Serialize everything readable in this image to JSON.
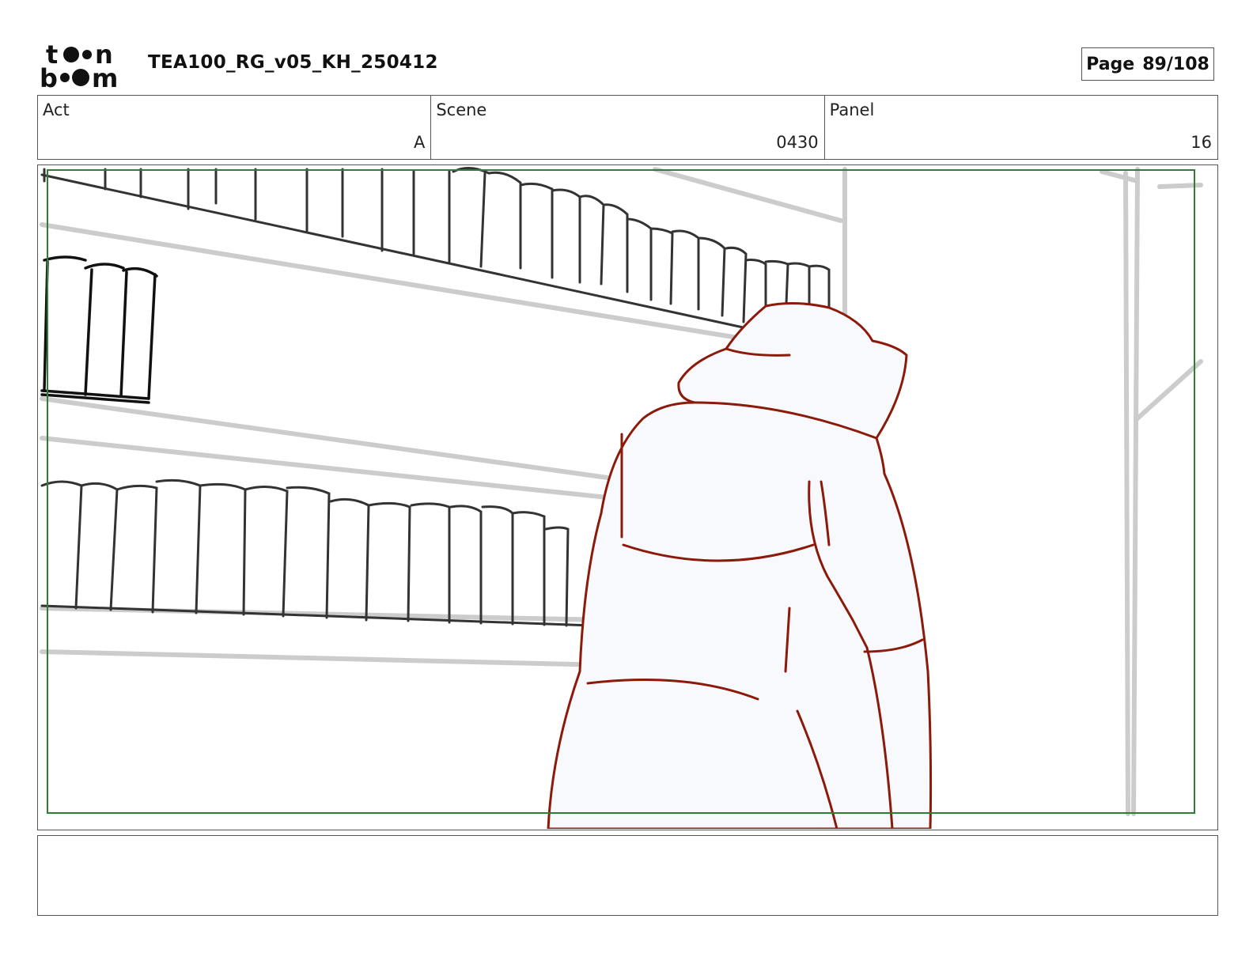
{
  "header": {
    "logo_text_top": "toon",
    "logo_text_bottom": "boom",
    "document_title": "TEA100_RG_v05_KH_250412",
    "page_label": "Page",
    "page_number": "89/108"
  },
  "info": {
    "act_label": "Act",
    "act_value": "A",
    "scene_label": "Scene",
    "scene_value": "0430",
    "panel_label": "Panel",
    "panel_value": "16"
  },
  "panel": {
    "safe_frame_color": "#2e7d32",
    "character_line_color": "#8b1a0a",
    "character_fill_color": "#f7f9fc",
    "shelf_line_color": "#cccccc",
    "book_line_color": "#333333"
  },
  "notes": {
    "text": ""
  }
}
